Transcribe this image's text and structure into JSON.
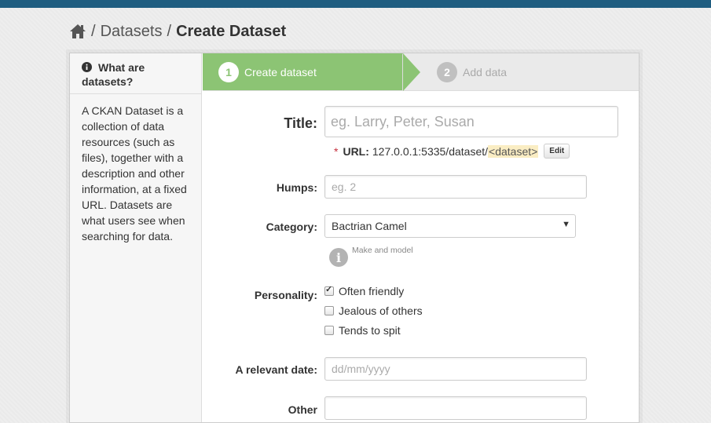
{
  "breadcrumb": {
    "home_icon": "home-icon",
    "items": [
      "Datasets"
    ],
    "current": "Create Dataset"
  },
  "aside": {
    "heading": "What are datasets?",
    "icon": "info-icon",
    "text": "A CKAN Dataset is a collection of data resources (such as files), together with a description and other information, at a fixed URL. Datasets are what users see when searching for data."
  },
  "stages": [
    {
      "number": "1",
      "label": "Create dataset",
      "active": true
    },
    {
      "number": "2",
      "label": "Add data",
      "active": false
    }
  ],
  "form": {
    "title": {
      "label": "Title:",
      "placeholder": "eg. Larry, Peter, Susan",
      "value": ""
    },
    "url": {
      "required_mark": "*",
      "label": "URL:",
      "prefix": "127.0.0.1:5335/dataset/",
      "slug": "<dataset>",
      "edit_button": "Edit"
    },
    "humps": {
      "label": "Humps:",
      "placeholder": "eg. 2"
    },
    "category": {
      "label": "Category:",
      "selected": "Bactrian Camel",
      "help": "Make and model",
      "help_icon": "info-circle-icon"
    },
    "personality": {
      "label": "Personality:",
      "options": [
        {
          "label": "Often friendly",
          "checked": true
        },
        {
          "label": "Jealous of others",
          "checked": false
        },
        {
          "label": "Tends to spit",
          "checked": false
        }
      ]
    },
    "date": {
      "label": "A relevant date:",
      "placeholder": "dd/mm/yyyy"
    },
    "other": {
      "label": "Other"
    }
  },
  "colors": {
    "topbar": "#1f5d80",
    "stage_active": "#8cc474",
    "url_slug_bg": "#faedc3"
  }
}
